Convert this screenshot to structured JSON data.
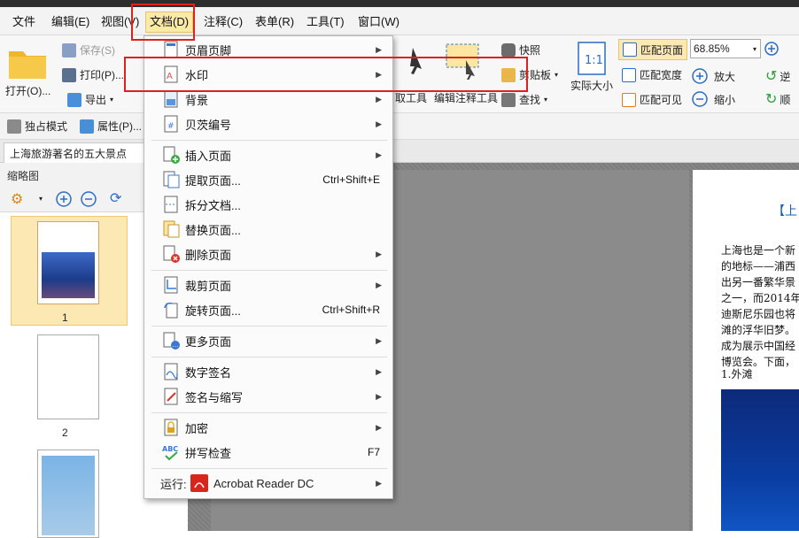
{
  "menubar": {
    "items": [
      {
        "label": "文件"
      },
      {
        "label": "编辑(E)"
      },
      {
        "label": "视图(V)"
      },
      {
        "label": "文档(D)"
      },
      {
        "label": "注释(C)"
      },
      {
        "label": "表单(R)"
      },
      {
        "label": "工具(T)"
      },
      {
        "label": "窗口(W)"
      }
    ]
  },
  "ribbon": {
    "open": "打开(O)...",
    "save": "保存(S)",
    "print": "打印(P)...",
    "export": "导出",
    "snapshot": "快照",
    "clipboard": "剪贴板",
    "find": "查找",
    "actual_size": "实际大小",
    "fit_page": "匹配页面",
    "fit_width": "匹配宽度",
    "fit_visible": "匹配可见",
    "zoom_value": "68.85%",
    "zoom_in": "放大",
    "zoom_out": "缩小",
    "rotate_ccw": "逆",
    "rotate_cw": "顺",
    "select_tool_partial": "取工具",
    "edit_annot_tool": "编辑注释工具"
  },
  "modebar": {
    "exclusive": "独占模式",
    "properties": "属性(P)..."
  },
  "tabs": {
    "doc_title": "上海旅游著名的五大景点"
  },
  "leftpanel": {
    "title": "缩略图",
    "pages": [
      "1",
      "2"
    ]
  },
  "document": {
    "heading": "【上",
    "lines": [
      "上海也是一个新",
      "的地标——浦西",
      "出另一番繁华景",
      "之一，而2014年",
      "迪斯尼乐园也将",
      "滩的浮华旧梦。",
      "成为展示中国经",
      "博览会。下面，"
    ],
    "section": "1.外滩"
  },
  "dropdown": {
    "items": [
      {
        "label": "页眉页脚",
        "shortcut": "",
        "submenu": true
      },
      {
        "label": "水印",
        "shortcut": "",
        "submenu": true
      },
      {
        "label": "背景",
        "shortcut": "",
        "submenu": true
      },
      {
        "label": "贝茨编号",
        "shortcut": "",
        "submenu": true
      },
      {
        "label": "插入页面",
        "shortcut": "",
        "submenu": true
      },
      {
        "label": "提取页面...",
        "shortcut": "Ctrl+Shift+E",
        "submenu": false
      },
      {
        "label": "拆分文档...",
        "shortcut": "",
        "submenu": false
      },
      {
        "label": "替换页面...",
        "shortcut": "",
        "submenu": false
      },
      {
        "label": "删除页面",
        "shortcut": "",
        "submenu": true
      },
      {
        "label": "裁剪页面",
        "shortcut": "",
        "submenu": true
      },
      {
        "label": "旋转页面...",
        "shortcut": "Ctrl+Shift+R",
        "submenu": false
      },
      {
        "label": "更多页面",
        "shortcut": "",
        "submenu": true
      },
      {
        "label": "数字签名",
        "shortcut": "",
        "submenu": true
      },
      {
        "label": "签名与缩写",
        "shortcut": "",
        "submenu": true
      },
      {
        "label": "加密",
        "shortcut": "",
        "submenu": true
      },
      {
        "label": "拼写检查",
        "shortcut": "F7",
        "submenu": false
      },
      {
        "label": "Acrobat Reader DC",
        "prefix": "运行:",
        "shortcut": "",
        "submenu": true
      }
    ]
  },
  "colors": {
    "highlight_red": "#e0201c",
    "active_menu": "#fbe9a7",
    "thumb_selected": "#fbe8b2",
    "doc_title_blue": "#1b5fb5"
  }
}
